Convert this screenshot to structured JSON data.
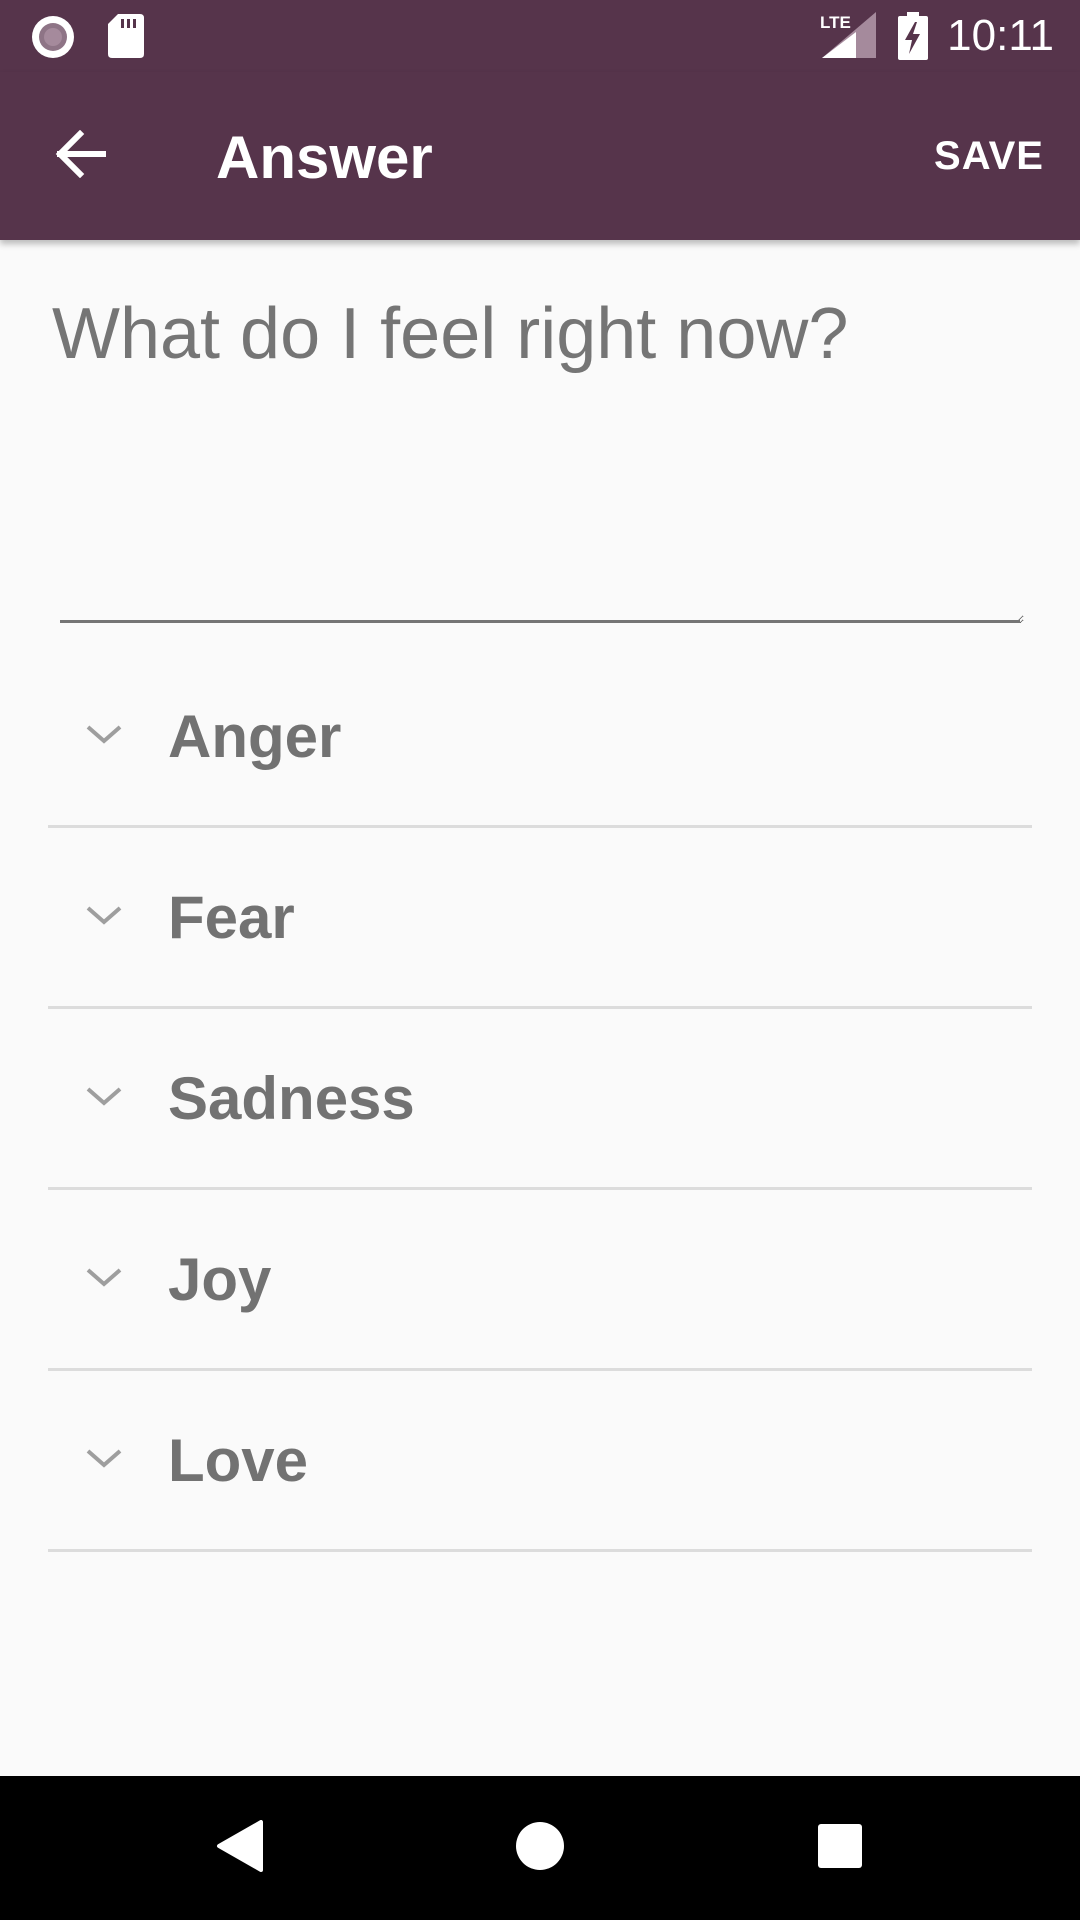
{
  "status_bar": {
    "time": "10:11",
    "network_label": "LTE",
    "icons": [
      "record-icon",
      "sd-card-icon",
      "lte-signal-icon",
      "battery-charging-icon"
    ]
  },
  "app_bar": {
    "title": "Answer",
    "save_label": "SAVE",
    "back_icon": "arrow-back-icon",
    "background_color": "#56344b"
  },
  "question": {
    "text": "What do I feel right now?"
  },
  "emotions": [
    {
      "label": "Anger",
      "icon": "chevron-down-icon"
    },
    {
      "label": "Fear",
      "icon": "chevron-down-icon"
    },
    {
      "label": "Sadness",
      "icon": "chevron-down-icon"
    },
    {
      "label": "Joy",
      "icon": "chevron-down-icon"
    },
    {
      "label": "Love",
      "icon": "chevron-down-icon"
    }
  ],
  "nav_bar": {
    "icons": [
      "nav-back-icon",
      "nav-home-icon",
      "nav-recents-icon"
    ]
  }
}
